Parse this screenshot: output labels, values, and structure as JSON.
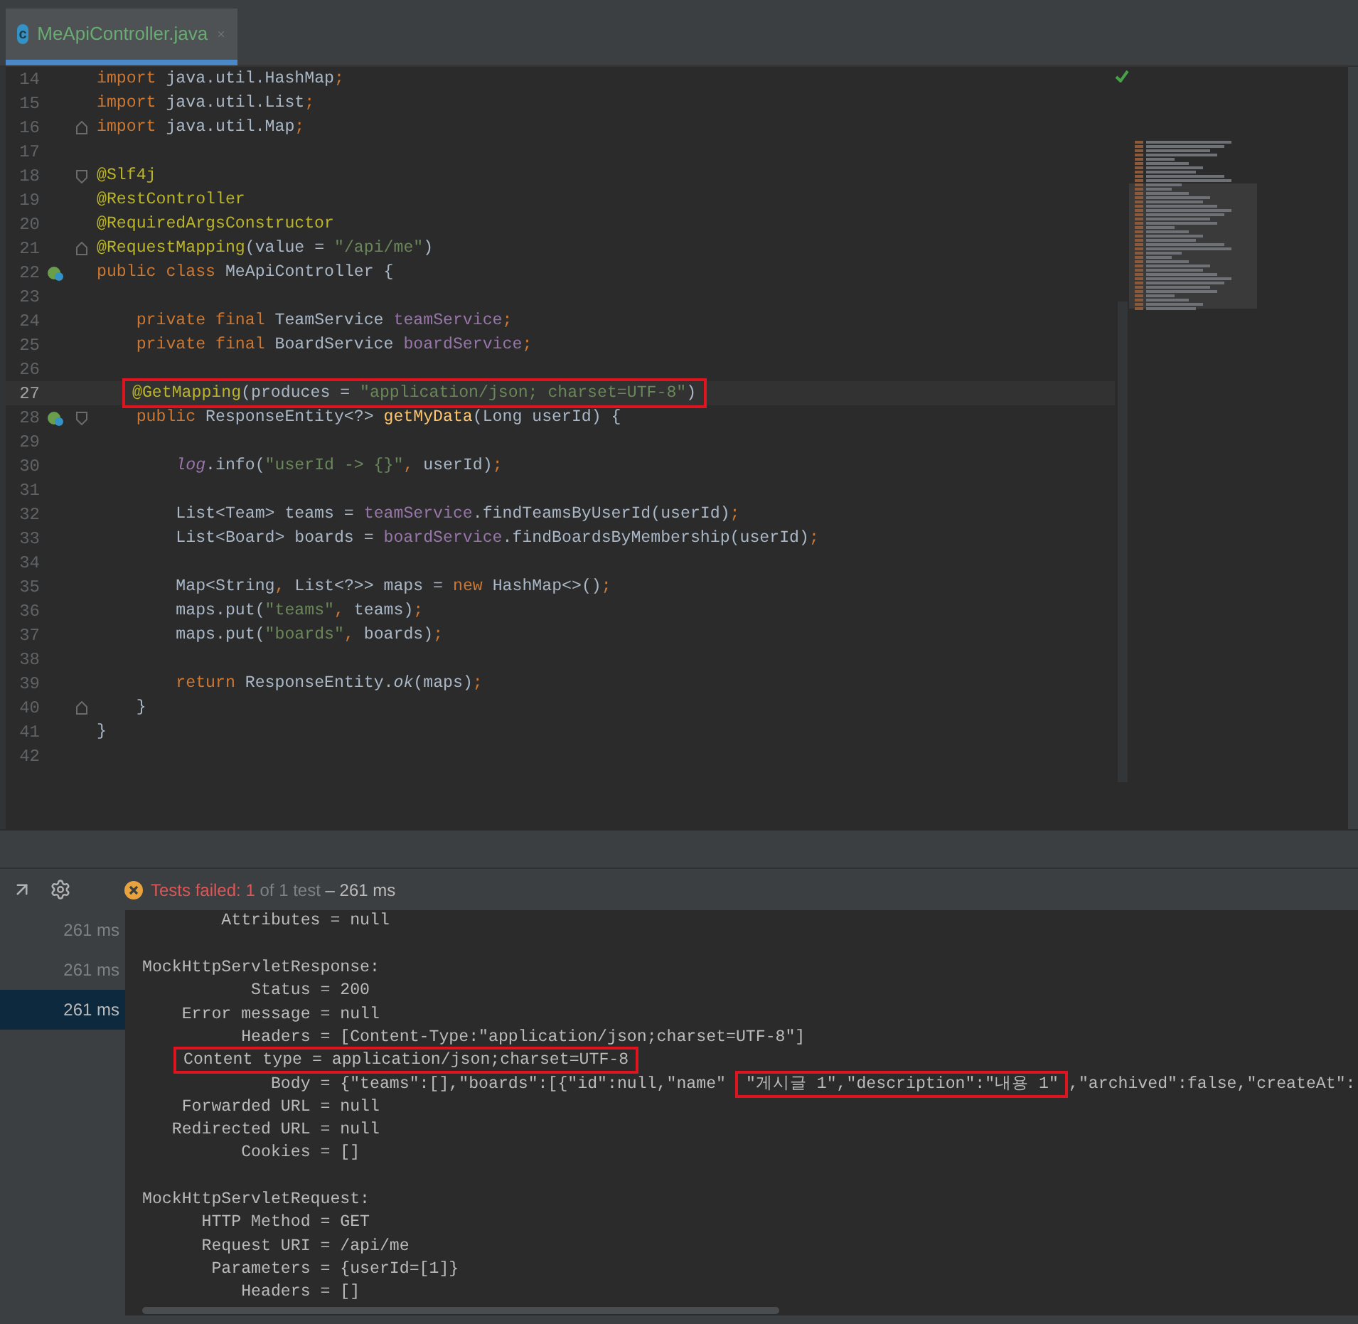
{
  "tab": {
    "icon_letter": "c",
    "title": "MeApiController.java",
    "selected": true
  },
  "editor": {
    "lines": [
      {
        "number": "14",
        "current": false,
        "before": [
          {
            "text": "import ",
            "kind": "kw"
          },
          {
            "text": "java.util.HashMap",
            "kind": "plain"
          },
          {
            "text": ";",
            "kind": "kw"
          }
        ]
      },
      {
        "number": "15",
        "current": false,
        "before": [
          {
            "text": "import ",
            "kind": "kw"
          },
          {
            "text": "java.util.List",
            "kind": "plain"
          },
          {
            "text": ";",
            "kind": "kw"
          }
        ]
      },
      {
        "number": "16",
        "current": false,
        "gutter": [
          {
            "kind": "fold_end"
          }
        ],
        "before": [
          {
            "text": "import ",
            "kind": "kw"
          },
          {
            "text": "java.util.Map",
            "kind": "plain"
          },
          {
            "text": ";",
            "kind": "kw"
          }
        ]
      },
      {
        "number": "17",
        "current": false
      },
      {
        "number": "18",
        "current": false,
        "gutter": [
          {
            "kind": "fold_start"
          }
        ],
        "before": [
          {
            "text": "@Slf4j",
            "kind": "ann"
          }
        ]
      },
      {
        "number": "19",
        "current": false,
        "before": [
          {
            "text": "@RestController",
            "kind": "ann"
          }
        ]
      },
      {
        "number": "20",
        "current": false,
        "before": [
          {
            "text": "@RequiredArgsConstructor",
            "kind": "ann"
          }
        ]
      },
      {
        "number": "21",
        "current": false,
        "gutter": [
          {
            "kind": "fold_end"
          }
        ],
        "before": [
          {
            "text": "@RequestMapping",
            "kind": "ann"
          },
          {
            "text": "(value = ",
            "kind": "plain"
          },
          {
            "text": "\"/api/me\"",
            "kind": "str"
          },
          {
            "text": ")",
            "kind": "plain"
          }
        ]
      },
      {
        "number": "22",
        "current": false,
        "gutter": [
          {
            "kind": "bean"
          }
        ],
        "before": [
          {
            "text": "public class ",
            "kind": "kw"
          },
          {
            "text": "MeApiController {",
            "kind": "plain"
          }
        ]
      },
      {
        "number": "23",
        "current": false
      },
      {
        "number": "24",
        "current": false,
        "before": [
          {
            "text": "    private final ",
            "kind": "kw"
          },
          {
            "text": "TeamService ",
            "kind": "plain"
          },
          {
            "text": "teamService",
            "kind": "field"
          },
          {
            "text": ";",
            "kind": "kw"
          }
        ]
      },
      {
        "number": "25",
        "current": false,
        "before": [
          {
            "text": "    private final ",
            "kind": "kw"
          },
          {
            "text": "BoardService ",
            "kind": "plain"
          },
          {
            "text": "boardService",
            "kind": "field"
          },
          {
            "text": ";",
            "kind": "kw"
          }
        ]
      },
      {
        "number": "26",
        "current": false
      },
      {
        "number": "27",
        "current": true,
        "boxed": [
          {
            "text": "@GetMapping",
            "kind": "ann"
          },
          {
            "text": "(produces = ",
            "kind": "plain"
          },
          {
            "text": "\"application/json; charset=UTF-8\"",
            "kind": "str"
          },
          {
            "text": ")",
            "kind": "plain"
          }
        ]
      },
      {
        "number": "28",
        "current": false,
        "gutter": [
          {
            "kind": "bean"
          },
          {
            "kind": "fold_start"
          }
        ],
        "before": [
          {
            "text": "    public ",
            "kind": "kw"
          },
          {
            "text": "ResponseEntity<?> ",
            "kind": "plain"
          },
          {
            "text": "getMyData",
            "kind": "method"
          },
          {
            "text": "(Long userId) {",
            "kind": "plain"
          }
        ]
      },
      {
        "number": "29",
        "current": false
      },
      {
        "number": "30",
        "current": false,
        "before": [
          {
            "text": "        log",
            "kind": "static_field"
          },
          {
            "text": ".info(",
            "kind": "plain"
          },
          {
            "text": "\"userId -> {}\"",
            "kind": "str"
          },
          {
            "text": ", ",
            "kind": "kw"
          },
          {
            "text": "userId)",
            "kind": "plain"
          },
          {
            "text": ";",
            "kind": "kw"
          }
        ]
      },
      {
        "number": "31",
        "current": false
      },
      {
        "number": "32",
        "current": false,
        "before": [
          {
            "text": "        List<Team> teams = ",
            "kind": "plain"
          },
          {
            "text": "teamService",
            "kind": "field"
          },
          {
            "text": ".findTeamsByUserId(userId)",
            "kind": "plain"
          },
          {
            "text": ";",
            "kind": "kw"
          }
        ]
      },
      {
        "number": "33",
        "current": false,
        "before": [
          {
            "text": "        List<Board> boards = ",
            "kind": "plain"
          },
          {
            "text": "boardService",
            "kind": "field"
          },
          {
            "text": ".findBoardsByMembership(userId)",
            "kind": "plain"
          },
          {
            "text": ";",
            "kind": "kw"
          }
        ]
      },
      {
        "number": "34",
        "current": false
      },
      {
        "number": "35",
        "current": false,
        "before": [
          {
            "text": "        Map<String",
            "kind": "plain"
          },
          {
            "text": ", ",
            "kind": "kw"
          },
          {
            "text": "List<?>> maps = ",
            "kind": "plain"
          },
          {
            "text": "new ",
            "kind": "kw"
          },
          {
            "text": "HashMap<>()",
            "kind": "plain"
          },
          {
            "text": ";",
            "kind": "kw"
          }
        ]
      },
      {
        "number": "36",
        "current": false,
        "before": [
          {
            "text": "        maps.put(",
            "kind": "plain"
          },
          {
            "text": "\"teams\"",
            "kind": "str"
          },
          {
            "text": ", ",
            "kind": "kw"
          },
          {
            "text": "teams)",
            "kind": "plain"
          },
          {
            "text": ";",
            "kind": "kw"
          }
        ]
      },
      {
        "number": "37",
        "current": false,
        "before": [
          {
            "text": "        maps.put(",
            "kind": "plain"
          },
          {
            "text": "\"boards\"",
            "kind": "str"
          },
          {
            "text": ", ",
            "kind": "kw"
          },
          {
            "text": "boards)",
            "kind": "plain"
          },
          {
            "text": ";",
            "kind": "kw"
          }
        ]
      },
      {
        "number": "38",
        "current": false
      },
      {
        "number": "39",
        "current": false,
        "before": [
          {
            "text": "        return ",
            "kind": "kw"
          },
          {
            "text": "ResponseEntity.",
            "kind": "plain"
          },
          {
            "text": "ok",
            "kind": "static_method"
          },
          {
            "text": "(maps)",
            "kind": "plain"
          },
          {
            "text": ";",
            "kind": "kw"
          }
        ]
      },
      {
        "number": "40",
        "current": false,
        "gutter": [
          {
            "kind": "fold_end"
          }
        ],
        "before": [
          {
            "text": "    }",
            "kind": "plain"
          }
        ]
      },
      {
        "number": "41",
        "current": false,
        "before": [
          {
            "text": "}",
            "kind": "plain"
          }
        ]
      },
      {
        "number": "42",
        "current": false
      }
    ]
  },
  "test_status": {
    "label": "Tests failed:",
    "failed": "1",
    "of_total": "of 1 test",
    "duration": "– 261 ms"
  },
  "tests": [
    {
      "time": "261 ms",
      "selected": false
    },
    {
      "time": "261 ms",
      "selected": false
    },
    {
      "time": "261 ms",
      "selected": true
    }
  ],
  "console": [
    [
      {
        "before": "        Attributes = null"
      }
    ],
    [
      {
        "before": "MockHttpServletResponse:"
      },
      {
        "before": "           Status = 200"
      },
      {
        "before": "    Error message = null"
      },
      {
        "before": "          Headers = [Content-Type:\"application/json;charset=UTF-8\"]"
      },
      {
        "boxed": "Content type = application/json;charset=UTF-8"
      },
      {
        "before": "             Body = {\"teams\":[],\"boards\":[{\"id\":null,\"name\" ",
        "boxed": "\"게시글 1\",\"description\":\"내용 1\"",
        "after": ",\"archived\":false,\"createAt\":"
      },
      {
        "before": "    Forwarded URL = null"
      },
      {
        "before": "   Redirected URL = null"
      },
      {
        "before": "          Cookies = []"
      }
    ],
    [
      {
        "before": "MockHttpServletRequest:"
      },
      {
        "before": "      HTTP Method = GET"
      },
      {
        "before": "      Request URI = /api/me"
      },
      {
        "before": "       Parameters = {userId=[1]}"
      },
      {
        "before": "          Headers = []"
      }
    ]
  ]
}
